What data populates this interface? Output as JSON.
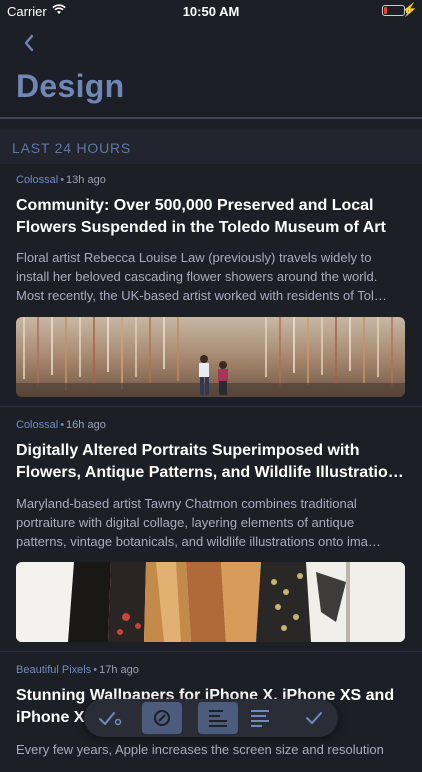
{
  "status_bar": {
    "carrier": "Carrier",
    "time": "10:50 AM",
    "battery_level": 0.15,
    "battery_color": "#ff3b30"
  },
  "nav": {
    "back_icon": "chevron-left-icon",
    "title": "Design"
  },
  "section": {
    "label": "LAST 24 HOURS"
  },
  "articles": [
    {
      "source": "Colossal",
      "age": "13h ago",
      "title": "Community: Over 500,000 Preserved and Local Flowers Suspended in the Toledo Museum of Art",
      "summary": "Floral artist Rebecca Louise Law (previously) travels widely to install her beloved cascading flower showers around the world. Most recently, the UK-based artist worked with residents of Tol…",
      "image": "flower-installation-thumbnail"
    },
    {
      "source": "Colossal",
      "age": "16h ago",
      "title": "Digitally Altered Portraits Superimposed with Flowers, Antique Patterns, and Wildlife Illustratio…",
      "summary": "Maryland-based artist Tawny Chatmon combines traditional portraiture with digital collage, layering elements of antique patterns, vintage botanicals, and wildlife illustrations onto ima…",
      "image": "portrait-collage-thumbnail"
    },
    {
      "source": "Beautiful Pixels",
      "age": "17h ago",
      "title": "Stunning Wallpapers for iPhone X, iPhone XS and iPhone X",
      "summary": "Every few years, Apple increases the screen size and resolution"
    }
  ],
  "toolbar": {
    "icons": [
      "mark-read-icon",
      "filter-icon",
      "text-align-left-icon",
      "text-align-justify-icon",
      "checkmark-icon"
    ],
    "accent": "#6f8cc2"
  }
}
